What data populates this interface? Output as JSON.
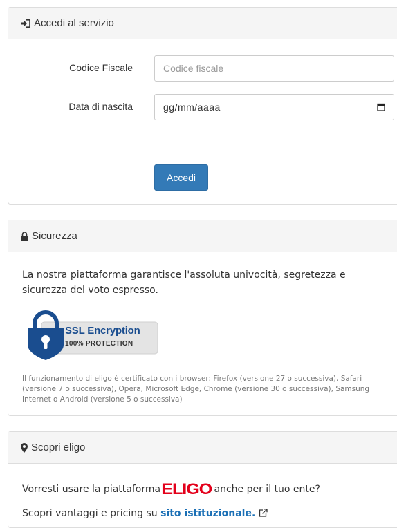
{
  "login": {
    "heading": "Accedi al servizio",
    "fiscal_code_label": "Codice Fiscale",
    "fiscal_code_placeholder": "Codice fiscale",
    "birth_date_label": "Data di nascita",
    "birth_date_placeholder": "gg/mm/aaaa",
    "submit_label": "Accedi"
  },
  "security": {
    "heading": "Sicurezza",
    "text": "La nostra piattaforma garantisce l'assoluta univocità, segretezza e sicurezza del voto espresso.",
    "badge_title": "SSL Encryption",
    "badge_subtitle": "100% PROTECTION",
    "browsers_note": "Il funzionamento di eligo è certificato con i browser: Firefox (versione 27 o successiva), Safari (versione 7 o successiva), Opera, Microsoft Edge, Chrome (versione 30 o successiva), Samsung Internet o Android (versione 5 o successiva)"
  },
  "discover": {
    "heading": "Scopri eligo",
    "line1_prefix": "Vorresti usare la piattaforma",
    "logo_text": "ELIGO",
    "line1_suffix": "anche per il tuo ente?",
    "line2_prefix": "Scopri vantaggi e pricing su",
    "link_text": "sito istituzionale."
  },
  "icons": {
    "login": "sign-in-icon",
    "security": "lock-icon",
    "discover": "map-marker-icon",
    "calendar": "calendar-icon",
    "external": "external-link-icon",
    "shield": "ssl-lock-icon"
  },
  "colors": {
    "primary_button": "#337ab7",
    "link": "#1a6fb5",
    "logo": "#e3001b",
    "badge_blue": "#1a4d8f"
  }
}
